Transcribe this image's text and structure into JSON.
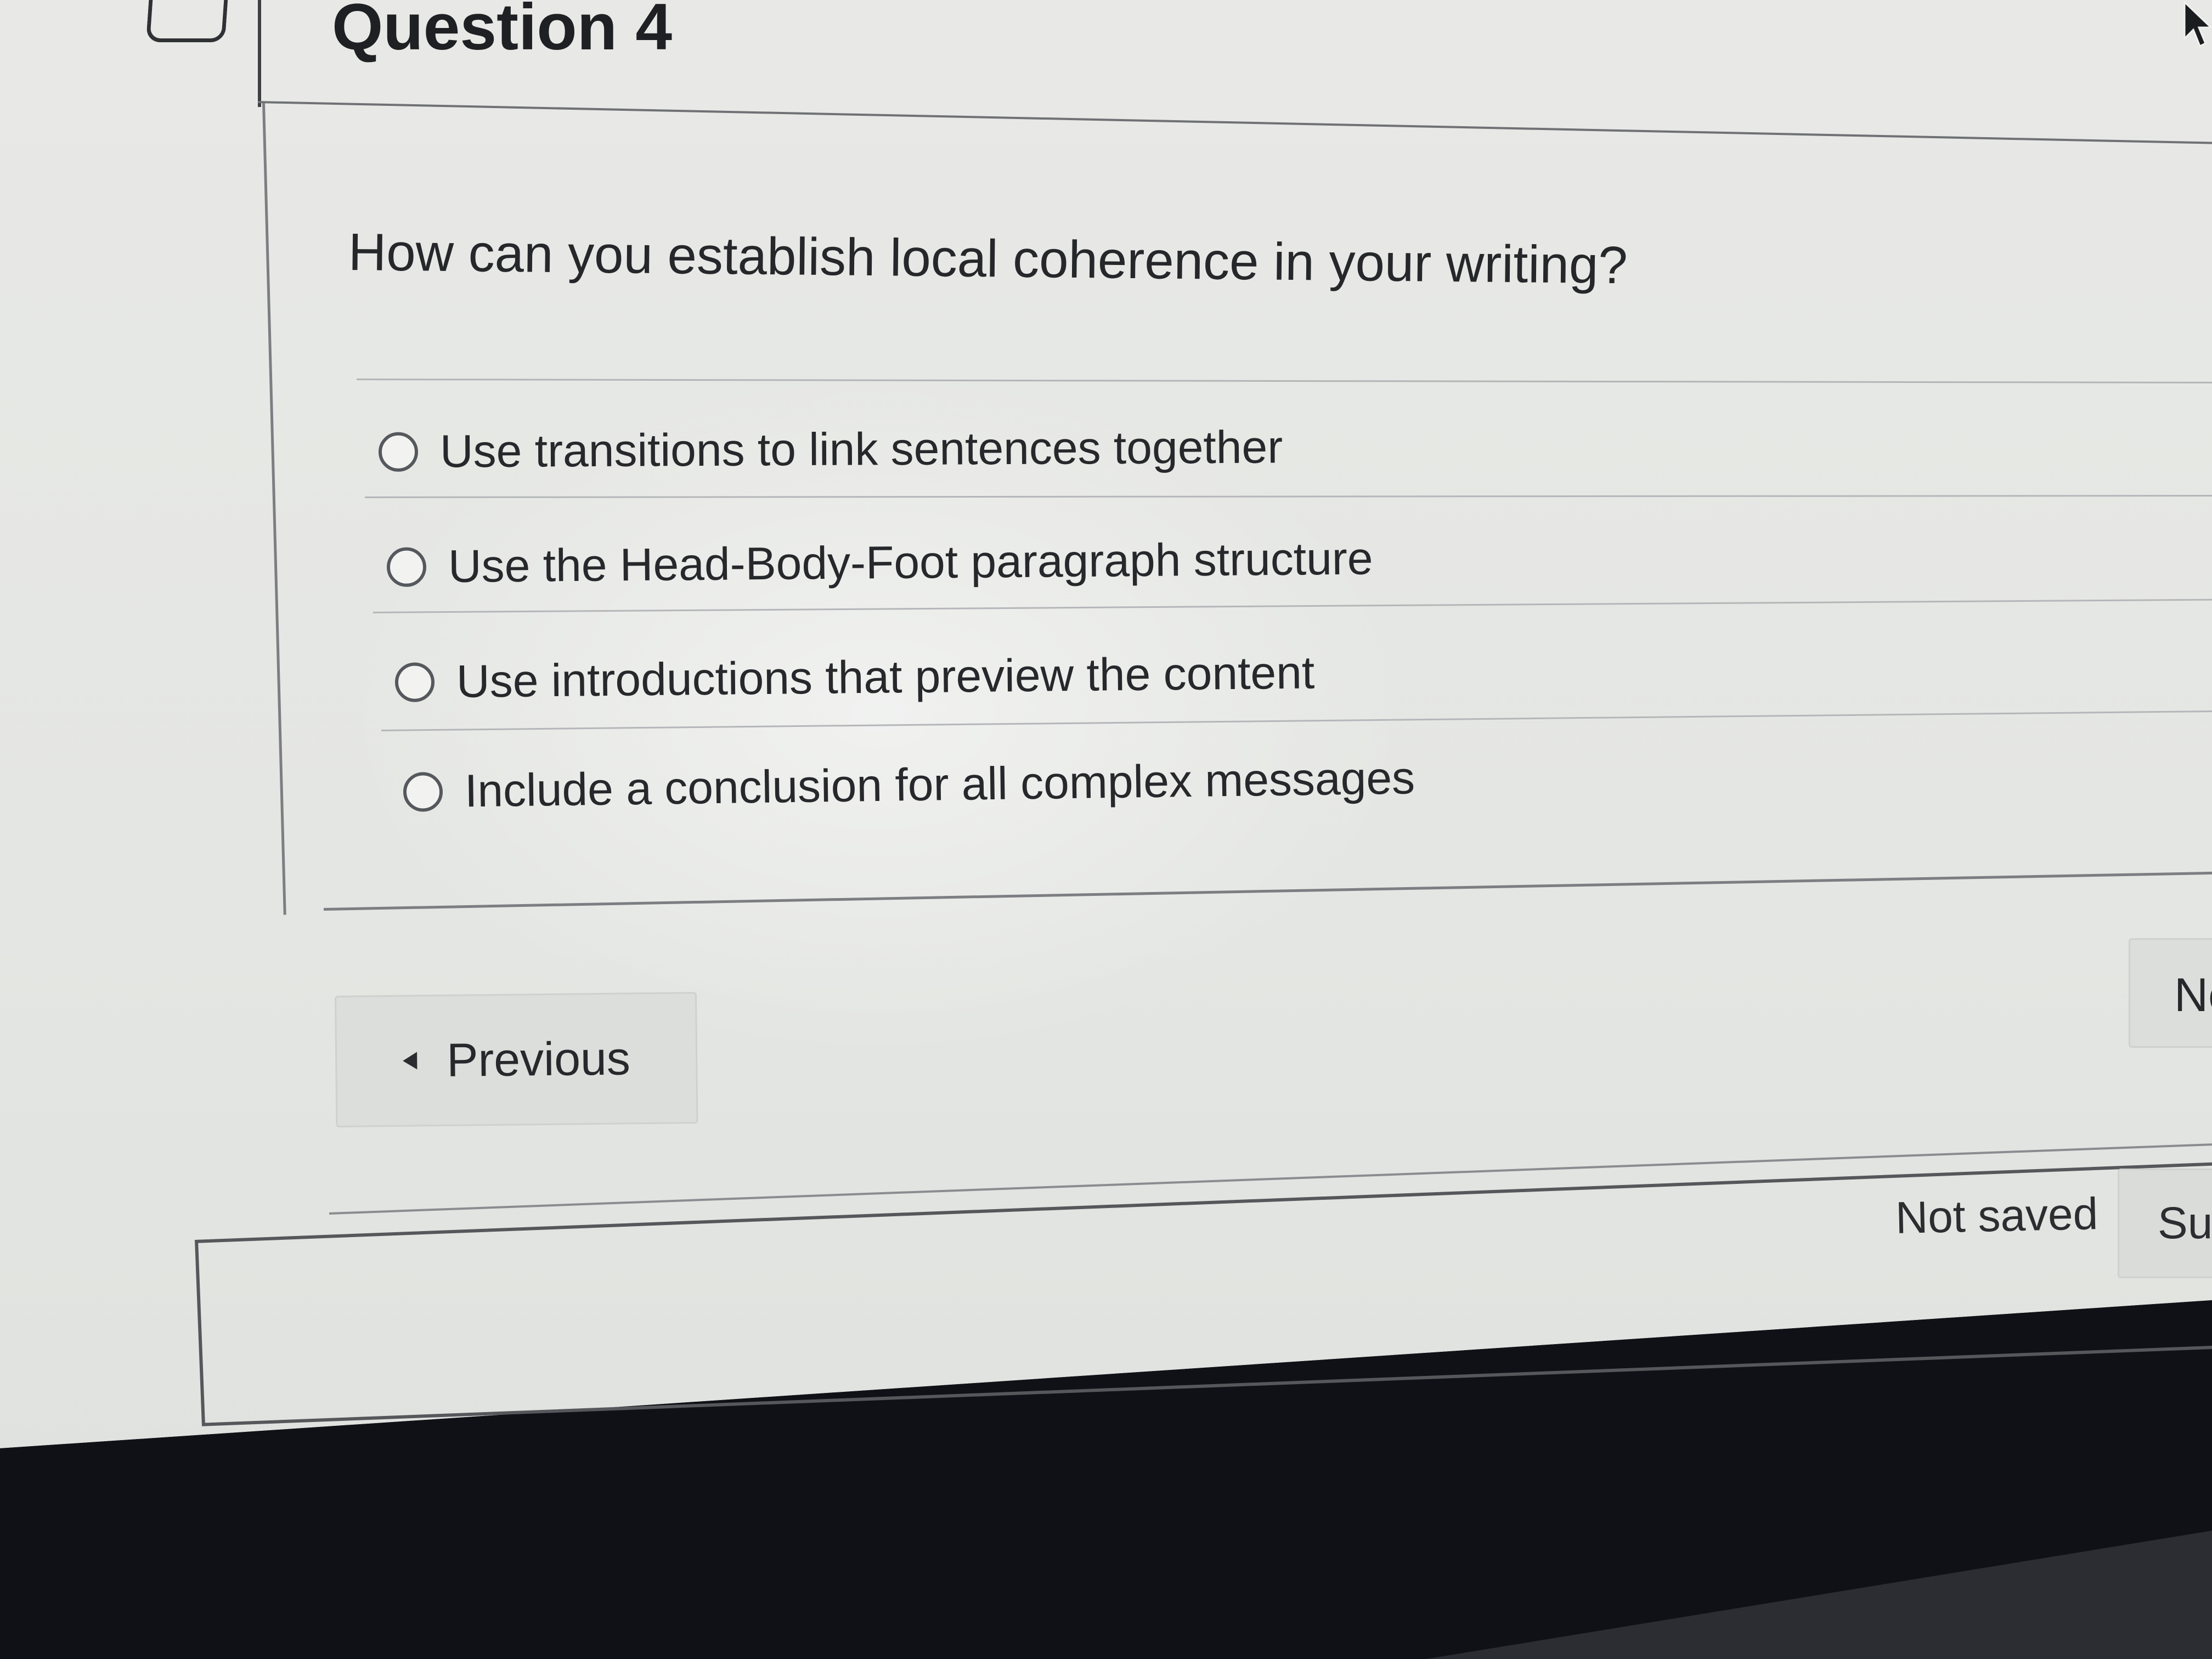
{
  "question": {
    "title": "Question 4",
    "text": "How can you establish local coherence in your writing?",
    "choices": [
      "Use transitions to link sentences together",
      "Use the Head-Body-Foot paragraph structure",
      "Use introductions that preview the content",
      "Include a conclusion for all complex messages"
    ]
  },
  "navigation": {
    "previous_label": "Previous",
    "next_label": "Ne"
  },
  "footer": {
    "status": "Not saved",
    "submit_label": "Sub"
  },
  "icons": {
    "previous": "caret-left-icon",
    "radio": "radio-unselected-icon",
    "cursor": "mouse-pointer-icon"
  }
}
